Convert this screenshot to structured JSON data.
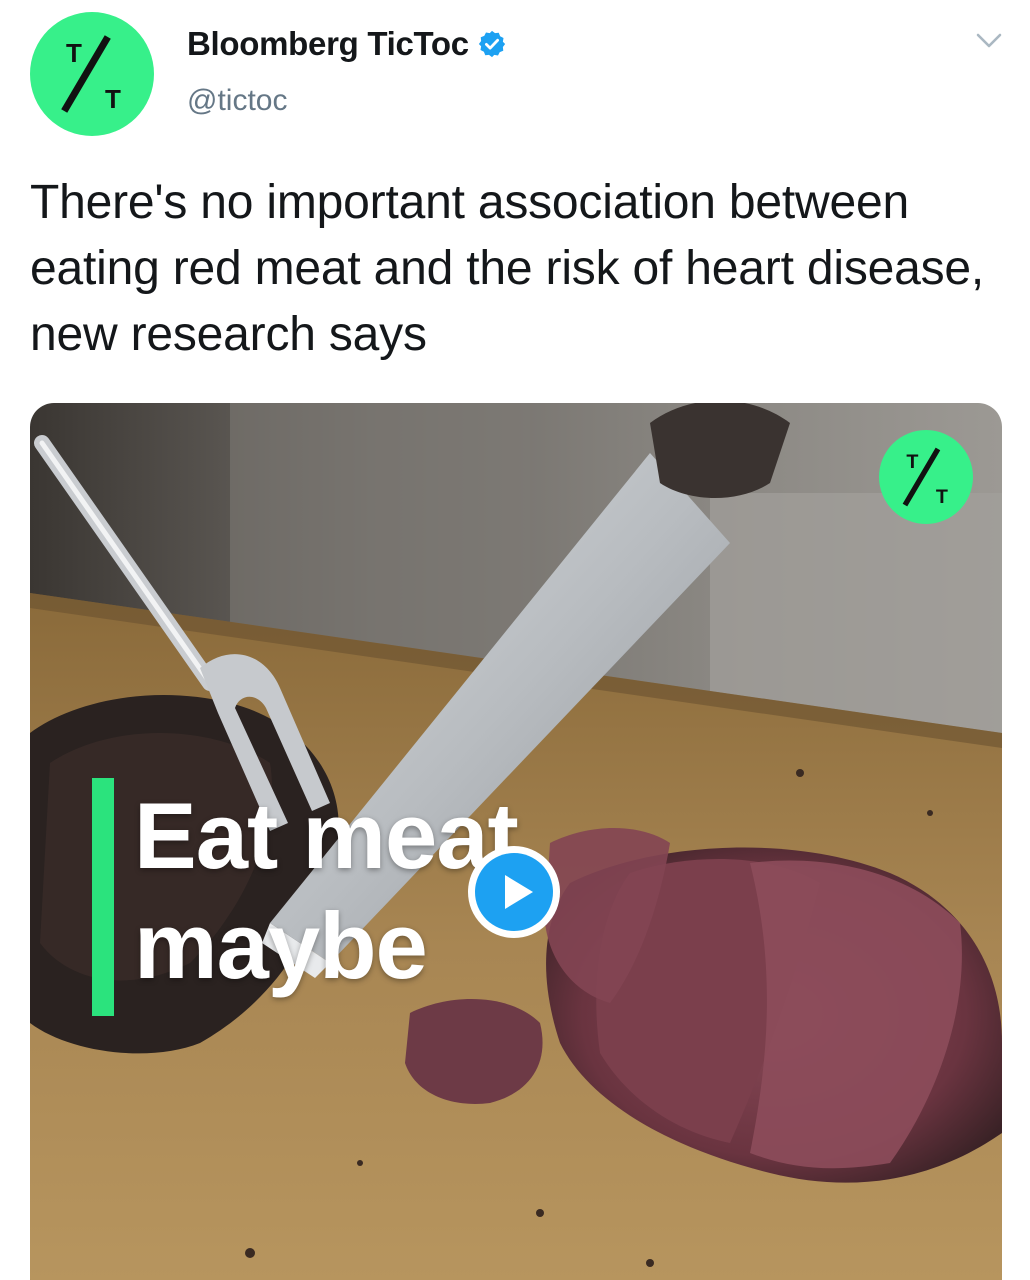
{
  "author": {
    "display_name": "Bloomberg TicToc",
    "handle": "@tictoc",
    "avatar_icon": "tictoc-logo-icon",
    "verified_icon": "verified-badge-icon"
  },
  "tweet": {
    "text": "There's no important association between eating red meat and the risk of heart disease, new research says"
  },
  "media": {
    "type": "video",
    "caption_line1": "Eat meat,",
    "caption_line2": "maybe",
    "overlay_logo_icon": "tictoc-logo-icon",
    "play_icon": "play-icon"
  },
  "colors": {
    "brand_green": "#37f08a",
    "caption_bar": "#2be37d",
    "verified_blue": "#1da1f2",
    "text": "#14171a",
    "secondary_text": "#657786"
  },
  "menu": {
    "icon": "chevron-down-icon"
  }
}
